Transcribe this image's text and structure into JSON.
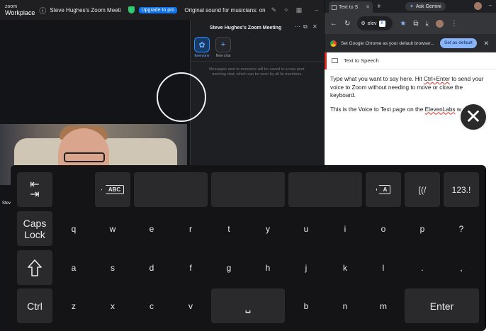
{
  "zoom": {
    "logo_line1": "zoom",
    "logo_line2": "Workplace",
    "meeting_title": "Steve Hughes's Zoom Meeti",
    "upgrade_label": "Upgrade to pro",
    "original_sound": "Original sound for musicians: on",
    "video_name": "Stev",
    "chat": {
      "title": "Steve Hughes's Zoom Meeting",
      "tabs": [
        {
          "label": "Everyone",
          "icon": "people-icon"
        },
        {
          "label": "New chat",
          "icon": "plus-icon"
        }
      ],
      "note": "Messages sent to everyone will be saved in a new post-meeting chat, which can be seen by all its members."
    }
  },
  "chrome": {
    "tab_title": "Text to S",
    "gemini_label": "Ask Gemini",
    "omnibox_text": "elev",
    "extension_badge": "8",
    "banner_text": "Set Google Chrome as your default browser...",
    "set_default_label": "Set as default",
    "page_title": "Text to Speech",
    "para1_a": "Type what you want to say here. Hit ",
    "para1_key": "Ctrl+Enter",
    "para1_b": " to send your voice to Zoom without needing to move or close the keyboard.",
    "para2_a": "This is the Voice to Text page on the ",
    "para2_brand": "ElevenLabs",
    "para2_b": " w"
  },
  "keyboard": {
    "row1": {
      "abc": "ABC",
      "a_tag": "A",
      "brackets": "[(/",
      "numbers": "123.!"
    },
    "caps": [
      "Caps",
      "Lock"
    ],
    "row2": [
      "q",
      "w",
      "e",
      "r",
      "t",
      "y",
      "u",
      "i",
      "o",
      "p",
      "?"
    ],
    "row3": [
      "a",
      "s",
      "d",
      "f",
      "g",
      "h",
      "j",
      "k",
      "l",
      ".",
      ","
    ],
    "row4_left": [
      "z",
      "x",
      "c",
      "v"
    ],
    "row4_right": [
      "b",
      "n",
      "m"
    ],
    "ctrl": "Ctrl",
    "space_symbol": "⎵",
    "enter": "Enter"
  },
  "colors": {
    "zoom_blue": "#0e72ed",
    "chrome_accent": "#8ab4f8",
    "keyboard_bg": "#141416",
    "key_bg": "#2a2a2c"
  }
}
